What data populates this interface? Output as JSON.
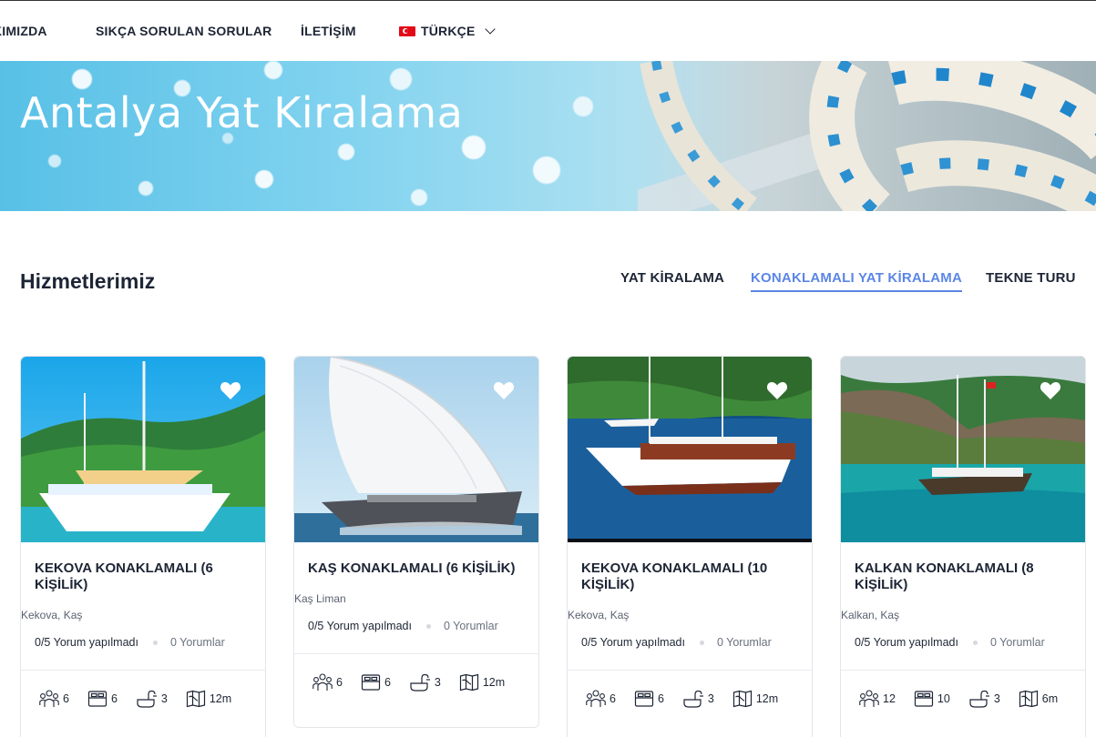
{
  "nav": {
    "about": "KIMIZDA",
    "faq": "SIKÇA SORULAN SORULAR",
    "contact": "İLETİŞİM",
    "language": "TÜRKÇE"
  },
  "hero": {
    "title": "Antalya Yat Kiralama"
  },
  "services": {
    "title": "Hizmetlerimiz",
    "tabs": [
      "YAT KİRALAMA",
      "KONAKLAMALI YAT KİRALAMA",
      "TEKNE TURU"
    ],
    "active_tab": "KONAKLAMALI YAT KİRALAMA"
  },
  "colors": {
    "accent": "#5b86e5",
    "text": "#1d2535"
  },
  "cards": [
    {
      "title": "KEKOVA KONAKLAMALI (6 KİŞİLİK)",
      "location": "Kekova, Kaş",
      "rating": "0/5 Yorum yapılmadı",
      "reviews": "0 Yorumlar",
      "guests": "6",
      "beds": "6",
      "baths": "3",
      "length": "12m"
    },
    {
      "title": "KAŞ KONAKLAMALI (6 KİŞİLİK)",
      "location": "Kaş Liman",
      "rating": "0/5 Yorum yapılmadı",
      "reviews": "0 Yorumlar",
      "guests": "6",
      "beds": "6",
      "baths": "3",
      "length": "12m"
    },
    {
      "title": "KEKOVA KONAKLAMALI (10 KİŞİLİK)",
      "location": "Kekova, Kaş",
      "rating": "0/5 Yorum yapılmadı",
      "reviews": "0 Yorumlar",
      "guests": "6",
      "beds": "6",
      "baths": "3",
      "length": "12m"
    },
    {
      "title": "KALKAN KONAKLAMALI (8 KİŞİLİK)",
      "location": "Kalkan, Kaş",
      "rating": "0/5 Yorum yapılmadı",
      "reviews": "0 Yorumlar",
      "guests": "12",
      "beds": "10",
      "baths": "3",
      "length": "6m"
    }
  ]
}
